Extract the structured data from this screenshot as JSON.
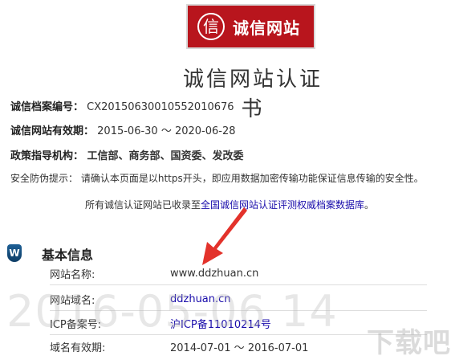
{
  "header": {
    "logo_text": "诚信网站",
    "logo_mark": "信",
    "title": "诚信网站认证书"
  },
  "summary": {
    "archive_label": "诚信档案编号：",
    "archive_value": "CX20150630010552010676",
    "validity_label": "诚信网站有效期：",
    "validity_value": "2015-06-30 ～ 2020-06-28",
    "agency_label": "政策指导机构：",
    "agency_value": "工信部、商务部、国资委、发改委",
    "security_label": "安全防伪提示：",
    "security_value": "请确认本页面是以https开头，即应用数据加密传输功能保证信息传输的安全性。"
  },
  "notice": {
    "prefix": "所有诚信认证网站已收录至",
    "link_text": "全国诚信网站认证评测权威档案数据库",
    "suffix": "。"
  },
  "basic_info": {
    "badge_text": "W",
    "title": "基本信息",
    "rows": [
      {
        "label": "网站名称:",
        "value": "www.ddzhuan.cn"
      },
      {
        "label": "网站域名:",
        "value": "ddzhuan.cn"
      },
      {
        "label": "ICP备案号:",
        "value": "沪ICP备11010214号"
      },
      {
        "label": "域名有效期:",
        "value": "2014-07-01 ～ 2016-07-01"
      }
    ]
  },
  "watermarks": {
    "date": "2016-05-06 14",
    "site": "下载吧"
  },
  "colors": {
    "brand_red": "#b8151d",
    "link_blue": "#1a0dab",
    "arrow_red": "#e3322b"
  }
}
